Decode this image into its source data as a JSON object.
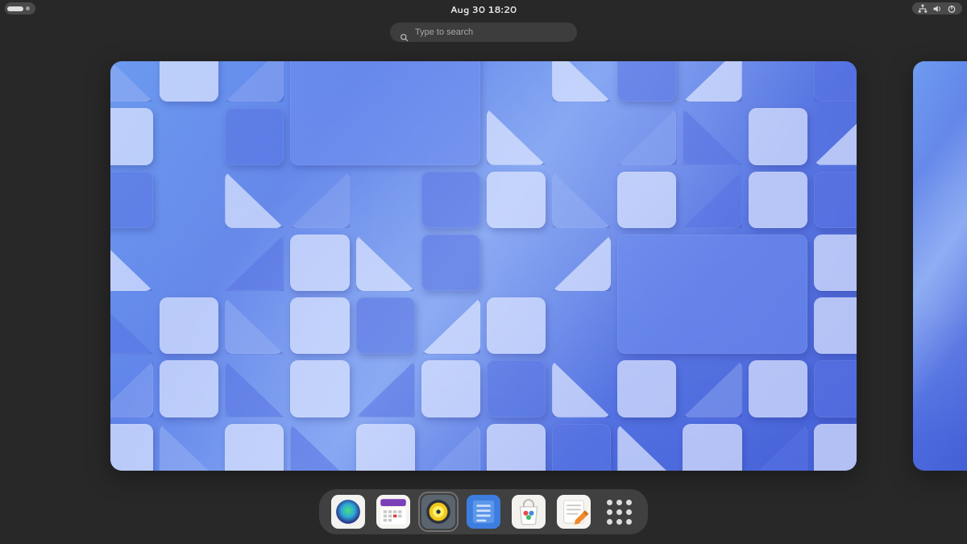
{
  "topbar": {
    "datetime": "Aug 30  18:20",
    "activities_icon": "activities-pill",
    "system_icons": [
      "network-wired-icon",
      "volume-icon",
      "power-icon"
    ]
  },
  "search": {
    "placeholder": "Type to search",
    "value": ""
  },
  "workspaces": {
    "current_index": 0,
    "wallpaper_name": "blue-triangles-abstract"
  },
  "dock": {
    "apps": [
      {
        "name": "web-browser",
        "icon": "globe-icon",
        "active": false
      },
      {
        "name": "calendar",
        "icon": "calendar-icon",
        "active": false
      },
      {
        "name": "music-player",
        "icon": "speaker-icon",
        "active": true
      },
      {
        "name": "todo",
        "icon": "todo-icon",
        "active": false
      },
      {
        "name": "software-store",
        "icon": "bag-icon",
        "active": false
      },
      {
        "name": "text-editor",
        "icon": "editor-icon",
        "active": false
      }
    ],
    "show_apps_label": "Show Applications"
  }
}
